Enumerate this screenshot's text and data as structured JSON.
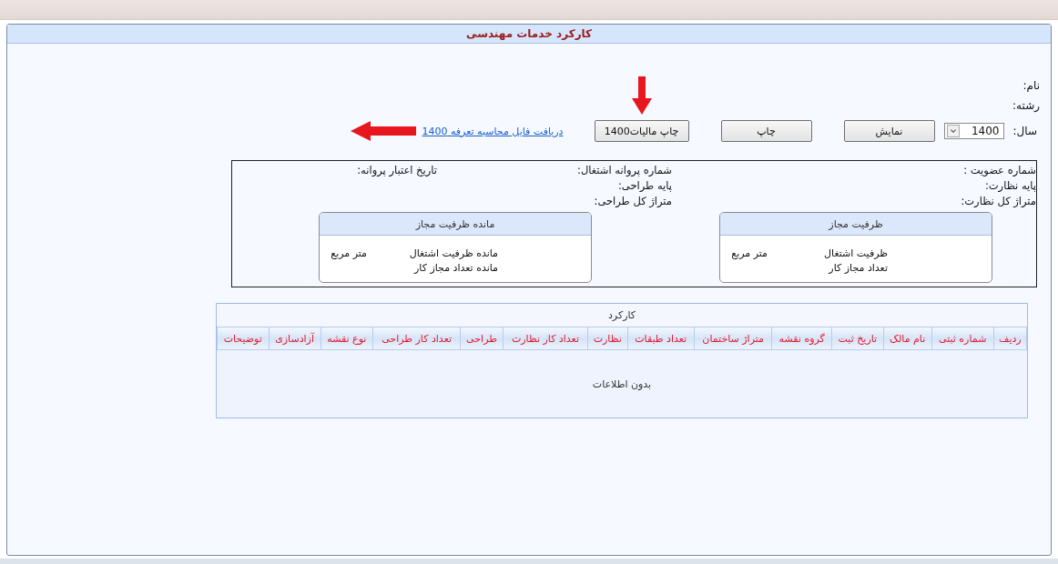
{
  "title": "کارکرد خدمات مهندسی",
  "fields": [
    {
      "label": "نام:"
    },
    {
      "label": "رشته:"
    }
  ],
  "year": {
    "label": "سال:",
    "value": "1400"
  },
  "buttons": [
    "نمایش",
    "چاپ",
    "چاپ مالیات1400"
  ],
  "link": "دریافت فایل محاسبه تعرفه 1400",
  "info_columns": [
    {
      "labels": [
        "شماره عضویت :",
        "پایه نظارت:",
        "متراژ کل نظارت:"
      ]
    },
    {
      "labels": [
        "شماره پروانه اشتغال:",
        "پایه طراحی:",
        "متراژ کل طراحی:"
      ]
    },
    {
      "labels": [
        "تاریخ اعتبار پروانه:"
      ]
    }
  ],
  "cards": [
    {
      "title": "ظرفیت مجاز",
      "rows": [
        {
          "label": "ظرفیت اشتغال",
          "unit": "متر مربع"
        },
        {
          "label": "تعداد مجاز کار"
        }
      ]
    },
    {
      "title": "مانده ظرفیت مجاز",
      "rows": [
        {
          "label": "مانده ظرفیت اشتغال",
          "unit": "متر مربع"
        },
        {
          "label": "مانده تعداد مجاز کار"
        }
      ]
    }
  ],
  "table": {
    "caption": "کارکرد",
    "columns": [
      "ردیف",
      "شماره ثبتی",
      "نام مالک",
      "تاریخ ثبت",
      "گروه نقشه",
      "متراژ ساختمان",
      "تعداد طبقات",
      "نظارت",
      "تعداد کار نظارت",
      "طراحی",
      "تعداد کار طراحی",
      "نوع نقشه",
      "آزادسازی",
      "توضیحات"
    ],
    "empty_text": "بدون اطلاعات"
  }
}
